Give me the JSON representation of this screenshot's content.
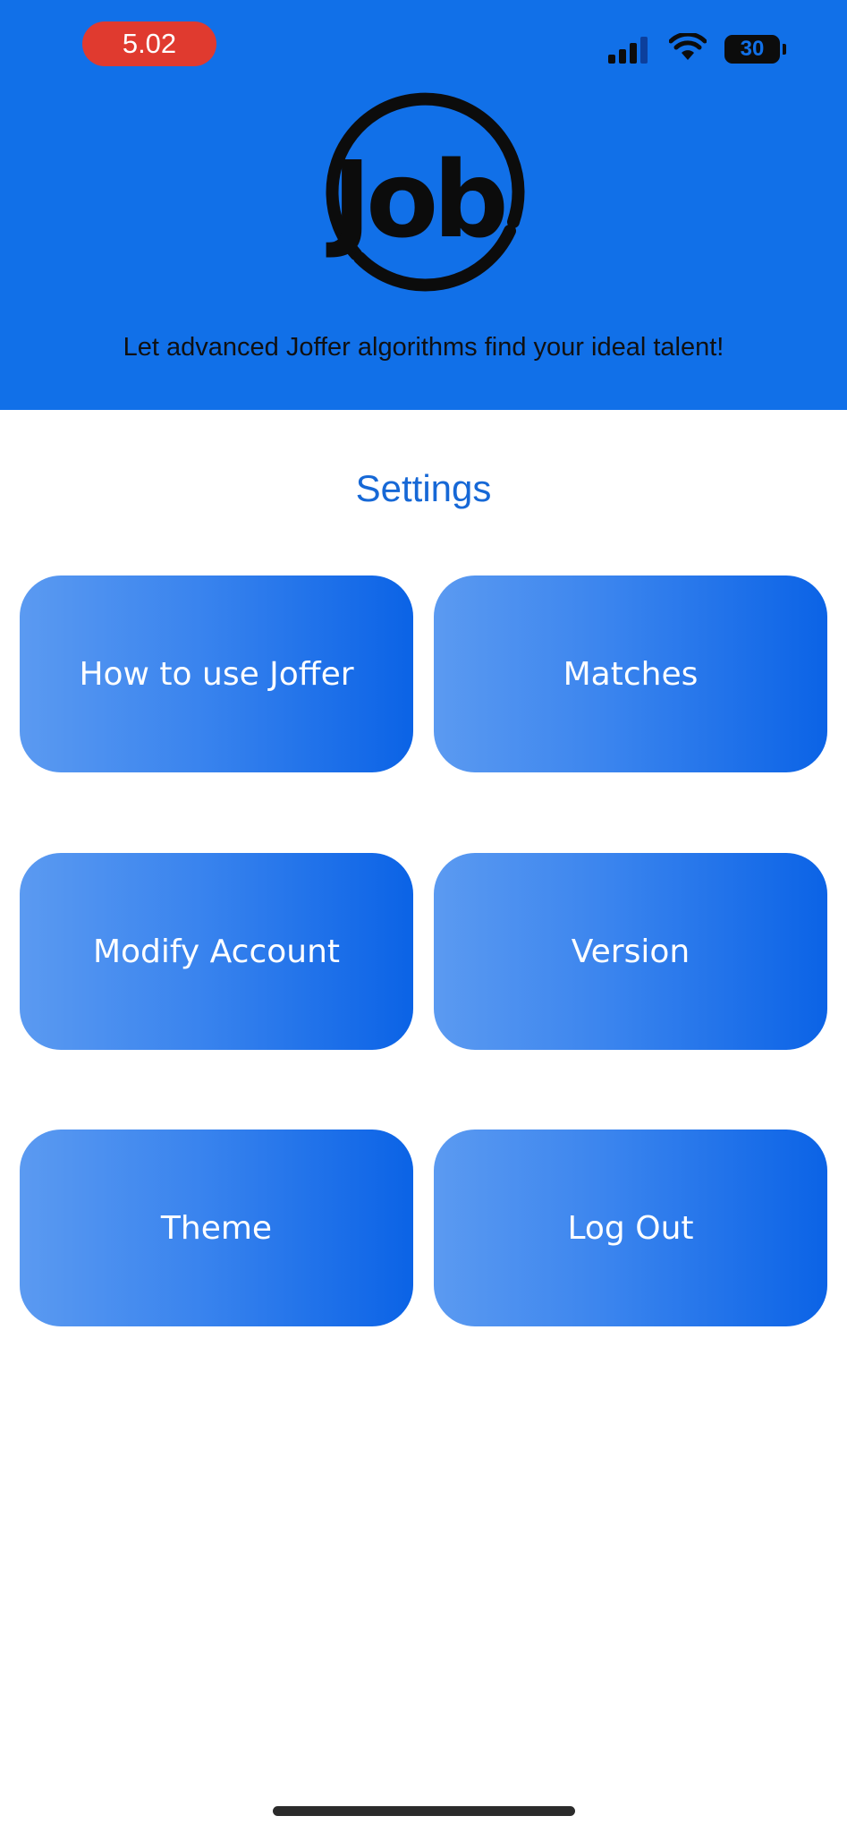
{
  "status_bar": {
    "time": "5.02",
    "battery_level": "30",
    "icons": [
      "signal-icon",
      "wifi-icon",
      "battery-icon"
    ]
  },
  "header": {
    "logo_text": "Job",
    "tagline": "Let advanced Joffer algorithms find your ideal talent!"
  },
  "main": {
    "title": "Settings",
    "buttons": [
      {
        "label": "How to use Joffer"
      },
      {
        "label": "Matches"
      },
      {
        "label": "Modify Account"
      },
      {
        "label": "Version"
      },
      {
        "label": "Theme"
      },
      {
        "label": "Log Out"
      }
    ]
  },
  "colors": {
    "header_bg": "#1170e8",
    "time_pill": "#e03a2f",
    "title": "#1668d6",
    "tile_gradient_start": "#5b9af1",
    "tile_gradient_end": "#0b63e6"
  }
}
